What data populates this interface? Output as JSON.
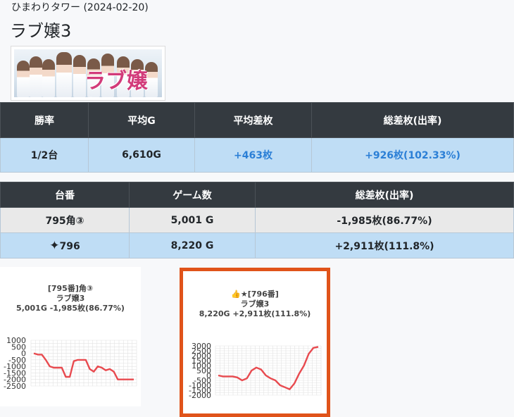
{
  "header": {
    "store_date": "ひまわりタワー (2024-02-20)",
    "machine_title": "ラブ嬢3"
  },
  "banner": {
    "logo_text": "ラブ嬢3"
  },
  "summary": {
    "headers": [
      "勝率",
      "平均G",
      "平均差枚",
      "総差枚(出率)"
    ],
    "win_rate": "1/2台",
    "avg_games": "6,610G",
    "avg_diff": "+463枚",
    "total_diff": "+926枚(102.33%)"
  },
  "machines": {
    "headers": [
      "台番",
      "ゲーム数",
      "総差枚(出率)"
    ],
    "rows": [
      {
        "number": "795角③",
        "games": "5,001 G",
        "diff": "-1,985枚(86.77%)"
      },
      {
        "number": "796",
        "games": "8,220 G",
        "diff": "+2,911枚(111.8%)"
      }
    ]
  },
  "charts": [
    {
      "title_line1": "[795番]角③",
      "title_line2": "ラブ嬢3",
      "title_line3": "5,001G -1,985枚(86.77%)",
      "y_ticks": [
        "1000",
        "500",
        "0",
        "-500",
        "-1000",
        "-1500",
        "-2000",
        "-2500"
      ]
    },
    {
      "title_line1": "👍★[796番]",
      "title_line2": "ラブ嬢3",
      "title_line3": "8,220G +2,911枚(111.8%)",
      "y_ticks": [
        "3000",
        "2500",
        "2000",
        "1500",
        "1000",
        "500",
        "0",
        "-500",
        "-1000",
        "-1500",
        "-2000"
      ]
    }
  ],
  "chart_data": [
    {
      "type": "line",
      "series": [
        {
          "values": [
            0,
            -100,
            -100,
            -500,
            -1000,
            -1100,
            -1100,
            -1100,
            -1800,
            -1800,
            -600,
            -500,
            -500,
            -500,
            -1200,
            -1400,
            -1000,
            -1100,
            -1300,
            -1200,
            -1400,
            -2000,
            -2000,
            -2000,
            -2000,
            -2000
          ]
        }
      ],
      "ylim": [
        -2500,
        1000
      ],
      "line_color": "#e84a4f"
    },
    {
      "type": "line",
      "series": [
        {
          "values": [
            0,
            -100,
            -100,
            -100,
            -200,
            -500,
            -300,
            500,
            800,
            600,
            0,
            -300,
            -500,
            -1000,
            -1200,
            -1400,
            -800,
            200,
            1000,
            2200,
            2800,
            2900
          ]
        }
      ],
      "ylim": [
        -2000,
        3000
      ],
      "line_color": "#e84a4f"
    }
  ],
  "colors": {
    "header_bg": "#343a40",
    "row_blue": "#bfddf5",
    "row_gray": "#e9e9e9",
    "link_blue": "#2b7fd6",
    "highlight_border": "#e0531a"
  },
  "icons": {
    "sparkle": "sparkle-icon"
  }
}
